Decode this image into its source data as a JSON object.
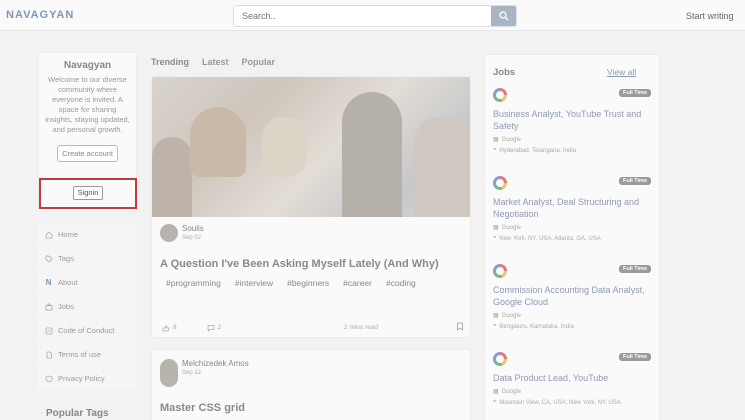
{
  "header": {
    "logo": "NAVAGYAN",
    "search_placeholder": "Search..",
    "start_writing": "Start writing"
  },
  "sidebar": {
    "title": "Navagyan",
    "description": "Welcome to our diverse community where everyone is invited. A space for sharing insights, staying updated, and personal growth.",
    "create_account": "Create account",
    "signin": "Signin",
    "nav": [
      {
        "label": "Home",
        "icon": "home-icon"
      },
      {
        "label": "Tags",
        "icon": "tag-icon"
      },
      {
        "label": "About",
        "icon": "navagyan-logo-icon"
      },
      {
        "label": "Jobs",
        "icon": "briefcase-icon"
      },
      {
        "label": "Code of Conduct",
        "icon": "document-icon"
      },
      {
        "label": "Terms of use",
        "icon": "file-icon"
      },
      {
        "label": "Privacy Policy",
        "icon": "shield-icon"
      }
    ],
    "popular_tags": "Popular Tags"
  },
  "feed": {
    "tabs": [
      "Trending",
      "Latest",
      "Popular"
    ],
    "posts": [
      {
        "author": "Soulis",
        "date": "Sep 02",
        "title": "A Question I've Been Asking Myself Lately (And Why)",
        "tags": [
          "#programming",
          "#interview",
          "#beginners",
          "#career",
          "#coding"
        ],
        "likes": "8",
        "comments": "2",
        "read_time": "2 mins read"
      },
      {
        "author": "Melchizedek Amos",
        "date": "Sep 12",
        "title": "Master CSS grid"
      }
    ]
  },
  "jobs": {
    "title": "Jobs",
    "view_all": "View all",
    "items": [
      {
        "badge": "Full Time",
        "title": "Business Analyst, YouTube Trust and Safety",
        "company": "Google",
        "location": "Hyderabad, Telangana, India"
      },
      {
        "badge": "Full Time",
        "title": "Market Analyst, Deal Structuring and Negotiation",
        "company": "Google",
        "location": "New York, NY, USA; Atlanta, GA, USA"
      },
      {
        "badge": "Full Time",
        "title": "Commission Accounting Data Analyst, Google Cloud",
        "company": "Google",
        "location": "Bengaluru, Karnataka, India"
      },
      {
        "badge": "Full Time",
        "title": "Data Product Lead, YouTube",
        "company": "Google",
        "location": "Mountain View, CA, USA; New York, NY, USA"
      }
    ]
  },
  "colors": {
    "highlight": "#c53b3b",
    "link": "#8e99b5"
  }
}
